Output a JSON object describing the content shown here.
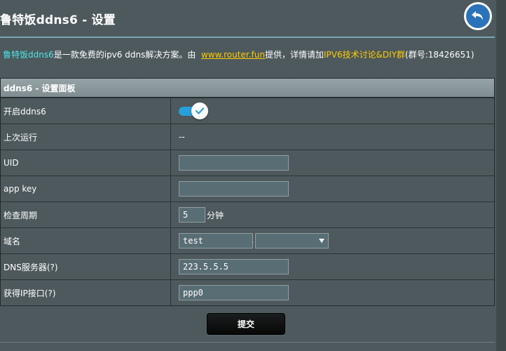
{
  "page": {
    "title": "鲁特饭ddns6 - 设置",
    "back_icon": "back-arrow-icon"
  },
  "description": {
    "product_name": "鲁特饭ddns6",
    "text1": "是一款免费的ipv6 ddns解决方案。由",
    "link": "www.router.fun",
    "text2": "提供，详情请加",
    "group_link": "IPV6技术讨论&DIY群",
    "group_number": "(群号:18426651)"
  },
  "panel": {
    "header": "ddns6 - 设置面板",
    "rows": {
      "enable": {
        "label": "开启ddns6",
        "enabled": true
      },
      "last_run": {
        "label": "上次运行",
        "value": "--"
      },
      "uid": {
        "label": "UID",
        "value": ""
      },
      "app_key": {
        "label": "app key",
        "value": ""
      },
      "interval": {
        "label": "检查周期",
        "value": "5",
        "unit": "分钟"
      },
      "domain": {
        "label": "域名",
        "value": "test",
        "separator": ".",
        "suffix": ""
      },
      "dns": {
        "label": "DNS服务器(?)",
        "value": "223.5.5.5"
      },
      "interface": {
        "label": "获得IP接口(?)",
        "value": "ppp0"
      }
    }
  },
  "actions": {
    "submit_label": "提交"
  },
  "colors": {
    "background": "#4d595d",
    "accent_cyan": "#4ee6e6",
    "accent_yellow": "#ffcc00",
    "toggle_blue": "#279fd9",
    "back_button": "#2b73b9"
  }
}
